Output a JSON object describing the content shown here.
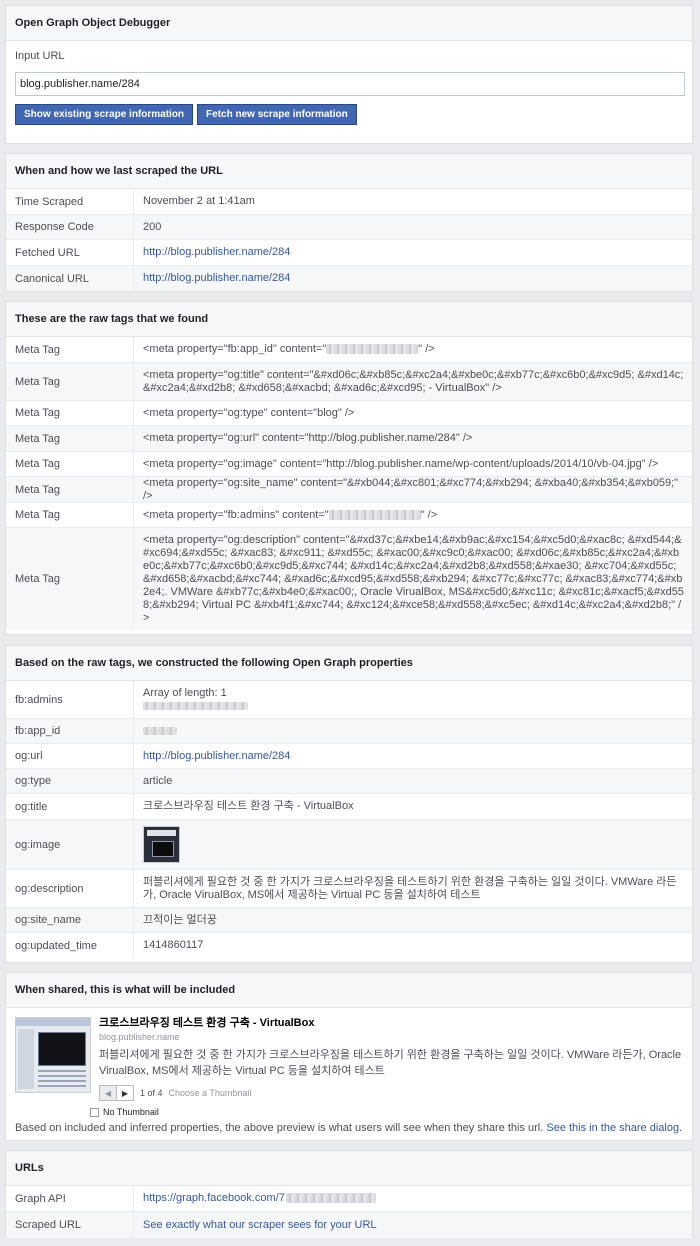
{
  "debugger": {
    "title": "Open Graph Object Debugger",
    "input_label": "Input URL",
    "input_value": "blog.publisher.name/284",
    "btn_existing": "Show existing scrape information",
    "btn_fetch": "Fetch new scrape information"
  },
  "scrape": {
    "title": "When and how we last scraped the URL",
    "rows": [
      {
        "k": "Time Scraped",
        "v": "November 2 at 1:41am"
      },
      {
        "k": "Response Code",
        "v": "200"
      },
      {
        "k": "Fetched URL",
        "v": "http://blog.publisher.name/284"
      },
      {
        "k": "Canonical URL",
        "v": "http://blog.publisher.name/284"
      }
    ]
  },
  "raw": {
    "title": "These are the raw tags that we found",
    "label": "Meta Tag",
    "rows": [
      {
        "pre": "<meta property=\"fb:app_id\" content=\"",
        "post": "\" />"
      },
      {
        "v": "<meta property=\"og:title\" content=\"&#xd06c;&#xb85c;&#xc2a4;&#xbe0c;&#xb77c;&#xc6b0;&#xc9d5; &#xd14c;&#xc2a4;&#xd2b8; &#xd658;&#xacbd; &#xad6c;&#xcd95; - VirtualBox\" />"
      },
      {
        "v": "<meta property=\"og:type\" content=\"blog\" />"
      },
      {
        "v": "<meta property=\"og:url\" content=\"http://blog.publisher.name/284\" />"
      },
      {
        "v": "<meta property=\"og:image\" content=\"http://blog.publisher.name/wp-content/uploads/2014/10/vb-04.jpg\" />"
      },
      {
        "v": "<meta property=\"og:site_name\" content=\"&#xb044;&#xc801;&#xc774;&#xb294; &#xba40;&#xb354;&#xb059;\" />"
      },
      {
        "pre": "<meta property=\"fb:admins\" content=\"",
        "post": "\" />"
      },
      {
        "v": "<meta property=\"og:description\" content=\"&#xd37c;&#xbe14;&#xb9ac;&#xc154;&#xc5d0;&#xac8c; &#xd544;&#xc694;&#xd55c; &#xac83; &#xc911; &#xd55c; &#xac00;&#xc9c0;&#xac00; &#xd06c;&#xb85c;&#xc2a4;&#xbe0c;&#xb77c;&#xc6b0;&#xc9d5;&#xc744; &#xd14c;&#xc2a4;&#xd2b8;&#xd558;&#xae30; &#xc704;&#xd55c; &#xd658;&#xacbd;&#xc744; &#xad6c;&#xcd95;&#xd558;&#xb294; &#xc77c;&#xc77c; &#xac83;&#xc774;&#xb2e4;. VMWare &#xb77c;&#xb4e0;&#xac00;, Oracle VirualBox, MS&#xc5d0;&#xc11c; &#xc81c;&#xacf5;&#xd558;&#xb294; Virtual PC &#xb4f1;&#xc744; &#xc124;&#xce58;&#xd558;&#xc5ec; &#xd14c;&#xc2a4;&#xd2b8;\" />"
      }
    ]
  },
  "og": {
    "title": "Based on the raw tags, we constructed the following Open Graph properties",
    "rows": [
      {
        "k": "fb:admins",
        "v": "Array of length: 1"
      },
      {
        "k": "fb:app_id",
        "v": ""
      },
      {
        "k": "og:url",
        "v": "http://blog.publisher.name/284"
      },
      {
        "k": "og:type",
        "v": "article"
      },
      {
        "k": "og:title",
        "v": "크로스브라우징 테스트 환경 구축 - VirtualBox"
      },
      {
        "k": "og:image",
        "v": ""
      },
      {
        "k": "og:description",
        "v": "퍼블리셔에게 필요한 것 중 한 가지가 크로스브라우징을 테스트하기 위한 환경을 구축하는 일일 것이다. VMWare 라든가, Oracle VirualBox, MS에서 제공하는 Virtual PC 등을 설치하여 테스트"
      },
      {
        "k": "og:site_name",
        "v": "끄적이는 멀더꿍"
      },
      {
        "k": "og:updated_time",
        "v": "1414860117"
      }
    ]
  },
  "share": {
    "title": "When shared, this is what will be included",
    "post_title": "크로스브라우징 테스트 환경 구축 - VirtualBox",
    "domain": "blog.publisher.name",
    "desc": "퍼블리셔에게 필요한 것 중 한 가지가 크로스브라우징을 테스트하기 위한 환경을 구축하는 일일 것이다. VMWare 라든가, Oracle VirualBox, MS에서 제공하는 Virtual PC 등을 설치하여 테스트",
    "counter": "1 of 4",
    "choose": "Choose a Thumbnail",
    "no_thumb": "No Thumbnail",
    "note": "Based on included and inferred properties, the above preview is what users will see when they share this url.",
    "note_link": "See this in the share dialog."
  },
  "urls": {
    "title": "URLs",
    "graph_label": "Graph API",
    "graph_value": "https://graph.facebook.com/7",
    "scraped_label": "Scraped URL",
    "scraped_value": "See exactly what our scraper sees for your URL"
  },
  "colors": {
    "link": "#365899",
    "button": "#4267b2",
    "bg": "#e9ebee"
  }
}
